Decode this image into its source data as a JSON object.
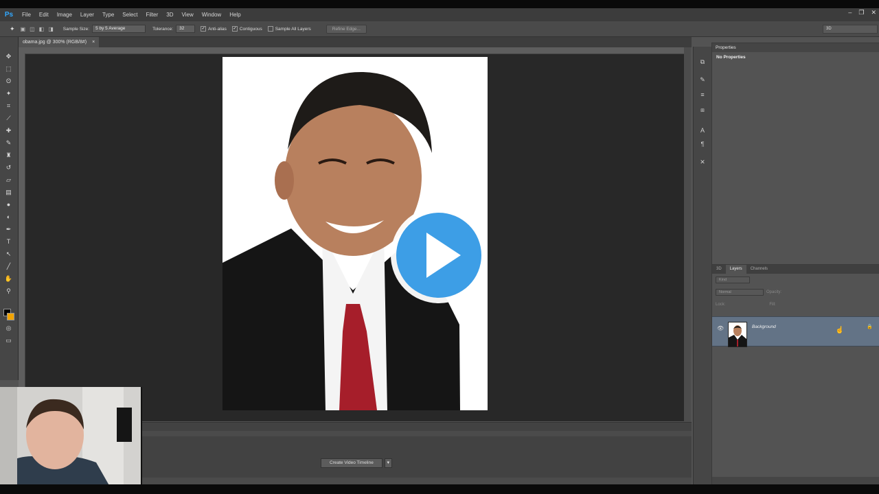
{
  "app": {
    "logo": "Ps",
    "minimize": "–",
    "restore": "❐",
    "close": "✕"
  },
  "menu": [
    "File",
    "Edit",
    "Image",
    "Layer",
    "Type",
    "Select",
    "Filter",
    "3D",
    "View",
    "Window",
    "Help"
  ],
  "options_bar": {
    "sample_size_label": "Sample Size:",
    "sample_size_value": "5 by 5 Average",
    "tolerance_label": "Tolerance:",
    "tolerance_value": "32",
    "anti_alias": "Anti-alias",
    "contiguous": "Contiguous",
    "sample_all_layers": "Sample All Layers",
    "refine_edge": "Refine Edge...",
    "workspace": "3D"
  },
  "document": {
    "tab_title": "obama.jpg @ 300% (RGB/8#)",
    "close": "×"
  },
  "timeline": {
    "button": "Create Video Timeline"
  },
  "properties": {
    "tab": "Properties",
    "message": "No Properties"
  },
  "layers_panel": {
    "tabs": [
      "3D",
      "Layers",
      "Channels"
    ],
    "filter": "Kind",
    "blend_mode": "Normal",
    "opacity_label": "Opacity:",
    "lock_label": "Lock:",
    "fill_label": "Fill:",
    "layer_name": "Background"
  },
  "colors": {
    "accent": "#31a8ff",
    "foreground": "#000000",
    "background": "#f2a400",
    "selected_layer": "#637386",
    "play_button": "#3d9ee6"
  }
}
